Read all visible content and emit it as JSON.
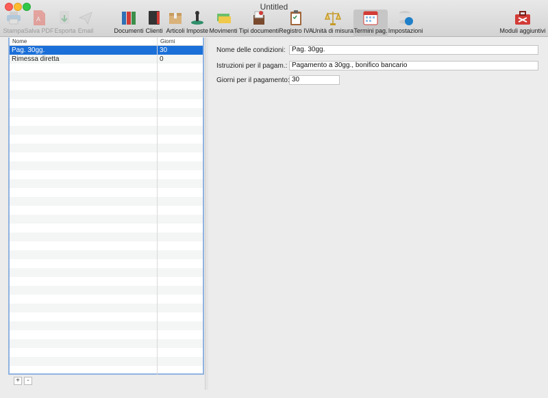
{
  "window": {
    "title": "Untitled"
  },
  "toolbar": {
    "items": [
      {
        "label": "Stampa",
        "icon": "printer-icon",
        "enabled": false
      },
      {
        "label": "Salva PDF",
        "icon": "pdf-icon",
        "enabled": false
      },
      {
        "label": "Esporta",
        "icon": "export-icon",
        "enabled": false
      },
      {
        "label": "Email",
        "icon": "paper-plane-icon",
        "enabled": false
      },
      {
        "label": "Documenti",
        "icon": "binders-icon",
        "enabled": true
      },
      {
        "label": "Clienti",
        "icon": "address-book-icon",
        "enabled": true
      },
      {
        "label": "Articoli",
        "icon": "box-icon",
        "enabled": true
      },
      {
        "label": "Imposte",
        "icon": "tax-stamp-icon",
        "enabled": true
      },
      {
        "label": "Movimenti",
        "icon": "money-icon",
        "enabled": true
      },
      {
        "label": "Tipi documenti",
        "icon": "document-types-icon",
        "enabled": true
      },
      {
        "label": "Registro IVA",
        "icon": "clipboard-icon",
        "enabled": true
      },
      {
        "label": "Unità di misura",
        "icon": "scale-icon",
        "enabled": true
      },
      {
        "label": "Termini pag.",
        "icon": "calendar-icon",
        "enabled": true,
        "selected": true
      },
      {
        "label": "Impostazioni",
        "icon": "database-wrench-icon",
        "enabled": true
      },
      {
        "label": "Moduli aggiuntivi",
        "icon": "toolbox-icon",
        "enabled": true
      }
    ]
  },
  "list": {
    "columns": [
      "Nome",
      "Giorni"
    ],
    "rows": [
      [
        "Pag. 30gg.",
        "30"
      ],
      [
        "Rimessa diretta",
        "0"
      ]
    ],
    "selected_index": 0,
    "add_label": "+",
    "remove_label": "-"
  },
  "form": {
    "name_label": "Nome delle condizioni:",
    "name_value": "Pag. 30gg.",
    "instructions_label": "Istruzioni per il pagam.:",
    "instructions_value": "Pagamento a 30gg., bonifico bancario",
    "days_label": "Giorni per il pagamento:",
    "days_value": "30"
  },
  "colors": {
    "selection": "#1b6fd8",
    "list_border": "#8fb2e0"
  }
}
